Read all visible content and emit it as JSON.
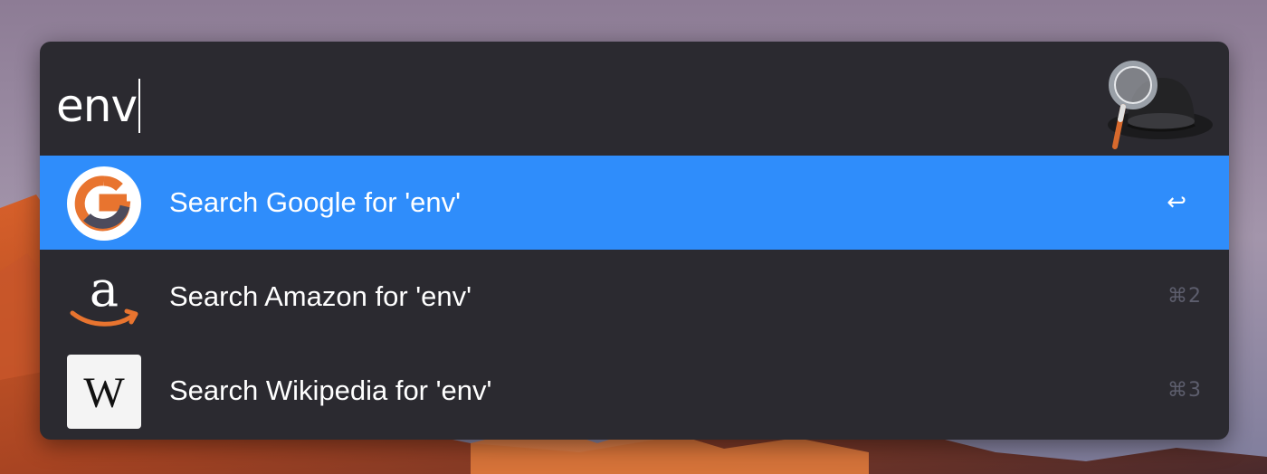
{
  "search": {
    "query": "env"
  },
  "results": [
    {
      "title": "Search Google for 'env'",
      "icon": "google-icon",
      "shortcut": "↩",
      "selected": true
    },
    {
      "title": "Search Amazon for 'env'",
      "icon": "amazon-icon",
      "shortcut": "⌘2",
      "selected": false
    },
    {
      "title": "Search Wikipedia for 'env'",
      "icon": "wikipedia-icon",
      "shortcut": "⌘3",
      "selected": false
    }
  ],
  "colors": {
    "window_bg": "#2b2a30",
    "selection": "#2f8dfb",
    "shortcut_text": "#5d5e6d"
  }
}
